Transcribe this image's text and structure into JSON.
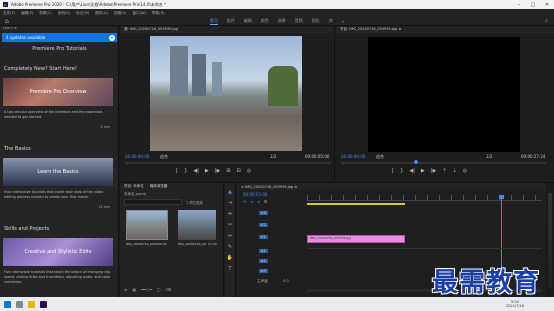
{
  "window": {
    "title": "Adobe Premiere Pro 2020 - C:\\用户\\Lion\\文档\\Adobe\\Premiere Pro\\14.0\\未命名 *",
    "app_badge": "Pr"
  },
  "menu": [
    "文件(F)",
    "编辑(E)",
    "剪辑(C)",
    "序列(S)",
    "标记(M)",
    "图形(G)",
    "视图(V)",
    "窗口(W)",
    "帮助(H)"
  ],
  "workspaces": [
    "学习",
    "组件",
    "编辑",
    "颜色",
    "效果",
    "音频",
    "图形",
    "库"
  ],
  "workspaces_more": "»",
  "learn": {
    "tab": "Learn ≡",
    "updates": "4 updates available",
    "panel_title": "Premiere Pro Tutorials",
    "sections": [
      {
        "heading": "Completely New? Start Here!",
        "card": "Premiere Pro Overview",
        "desc": "A two-minute overview of the interface and the essentials needed to get started.",
        "duration": "2 min"
      },
      {
        "heading": "The Basics",
        "card": "Learn the Basics",
        "desc": "Four interactive tutorials that cover each step of the video editing process needed to create your first movie.",
        "duration": "15 min"
      },
      {
        "heading": "Skills and Projects",
        "card": "Creative and Stylistic Edits",
        "desc": "Five interactive tutorials that teach the basics of changing clip speed, adding titles and transitions, adjusting audio, and color correction.",
        "duration": ""
      }
    ]
  },
  "source": {
    "tab": "源: IMG_20200716_093939.jpg",
    "timecode_left": "00:00:00:00",
    "fit": "适合",
    "page": "1/2",
    "timecode_right": "00:00:05:00"
  },
  "program": {
    "tab": "节目: IMG_20200716_093939.jpg ≡",
    "timecode_left": "00:00:00:00",
    "fit": "适合",
    "page": "1/2",
    "timecode_right": "00:00:27:24"
  },
  "project": {
    "tab1": "项目: 未命名",
    "tab2": "媒体浏览器",
    "file": "未命名.prproj",
    "count": "1 项已选择",
    "clips": [
      {
        "name": "IMG_20200716_09393...",
        "dur": "5:00"
      },
      {
        "name": "IMG_20200716_09393...",
        "dur": "27:24"
      }
    ]
  },
  "timeline": {
    "tab": "× IMG_20200716_093939.jpg ≡",
    "timecode": "00:00:03:00",
    "clip_label": "IMG_20200716_093939.jpg",
    "tracks_v": [
      "V3",
      "V2",
      "V1"
    ],
    "tracks_a": [
      "A1",
      "A2",
      "A3"
    ],
    "master": "主声道",
    "master_val": "0.0"
  },
  "taskbar": {
    "time": "9:50",
    "date": "2021/7/16"
  },
  "watermark": "最需教育",
  "colors": {
    "accent": "#3f8bf4",
    "update_blue": "#1473e6",
    "clip_pink": "#e88ee0",
    "playhead": "#3f8bf4"
  }
}
